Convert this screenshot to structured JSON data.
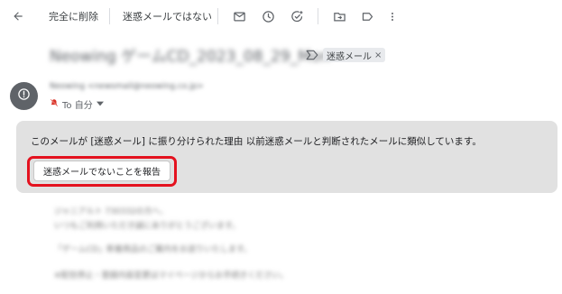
{
  "toolbar": {
    "back_icon": "arrow-left-icon",
    "delete_forever_label": "完全に削除",
    "not_spam_label": "迷惑メールではない",
    "icons": [
      "mail-icon",
      "clock-icon",
      "add-task-icon",
      "move-to-folder-icon",
      "label-icon",
      "more-vert-icon"
    ]
  },
  "email": {
    "subject": "Neowing ゲームCD_2023_08_29_Mon",
    "label_chip": "迷惑メール",
    "label_chip_remove": "×",
    "sender": "Neowing <newsmail@neowing.co.jp>",
    "to_label": "To 自分",
    "avatar_icon": "alert-icon"
  },
  "spam_warning": {
    "message": "このメールが [迷惑メール] に振り分けられた理由 以前迷惑メールと判断されたメールに類似しています。",
    "report_button": "迷惑メールでないことを報告",
    "highlight_color": "#e4121f"
  },
  "body_lines": [
    "ジャニアルト 730332の方へ、",
    "いつもご利用いただき誠にありがとうございます。",
    "「ゲームCD」新着商品のご案内をお送りいたします。",
    "※配信停止・登録内容変更はマイページからお手続きください。"
  ]
}
